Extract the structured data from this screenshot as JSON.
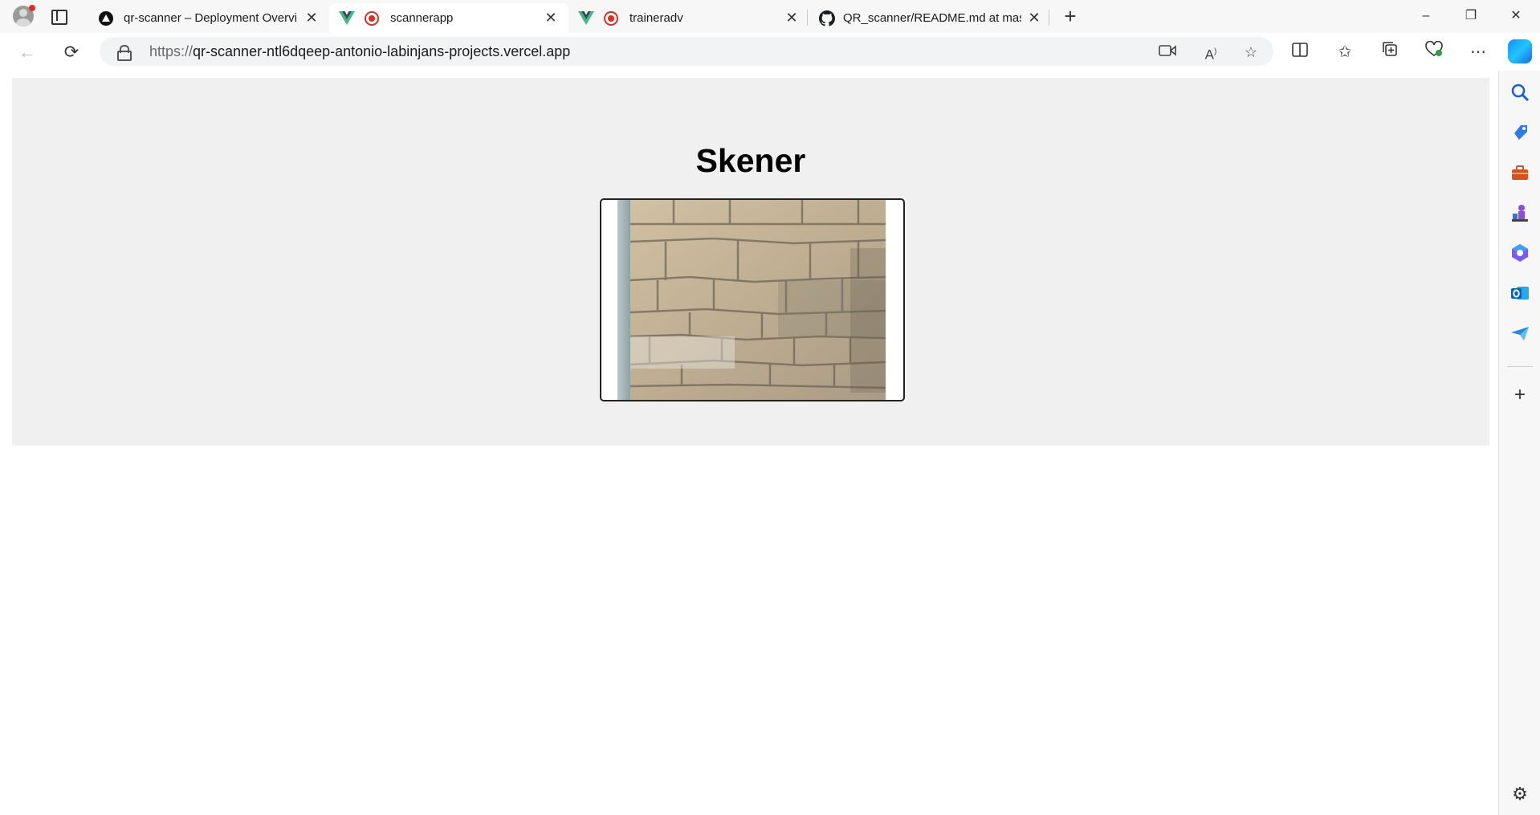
{
  "browser": {
    "tabs": [
      {
        "title": "qr-scanner – Deployment Overvi",
        "favicon": "vercel-icon",
        "active": false
      },
      {
        "title": "scannerapp",
        "favicon": "vue-icon",
        "recording": true,
        "active": true
      },
      {
        "title": "traineradv",
        "favicon": "vue-icon",
        "recording": true,
        "active": false
      },
      {
        "title": "QR_scanner/README.md at mast",
        "favicon": "github-icon",
        "active": false
      }
    ],
    "new_tab_label": "+",
    "window_controls": {
      "minimize": "–",
      "restore": "❐",
      "close": "✕"
    },
    "address": {
      "protocol": "https://",
      "host": "qr-scanner-ntl6dqeep-antonio-labinjans-projects.vercel.app"
    },
    "toolbar_icons": [
      "camera-icon",
      "read-aloud-icon",
      "favorite-star-icon",
      "split-screen-icon",
      "favorites-icon",
      "collections-icon",
      "browser-essentials-icon",
      "more-icon",
      "copilot-icon"
    ],
    "sidebar_icons": [
      "search-icon",
      "shopping-icon",
      "tools-icon",
      "games-icon",
      "microsoft-365-icon",
      "outlook-icon",
      "send-icon",
      "add-icon",
      "settings-icon"
    ]
  },
  "app": {
    "title": "Skener"
  },
  "colors": {
    "panel_bg": "#f0f0f0",
    "recording_red": "#d93025",
    "vue_green": "#41b883",
    "vue_dark": "#35495e"
  }
}
